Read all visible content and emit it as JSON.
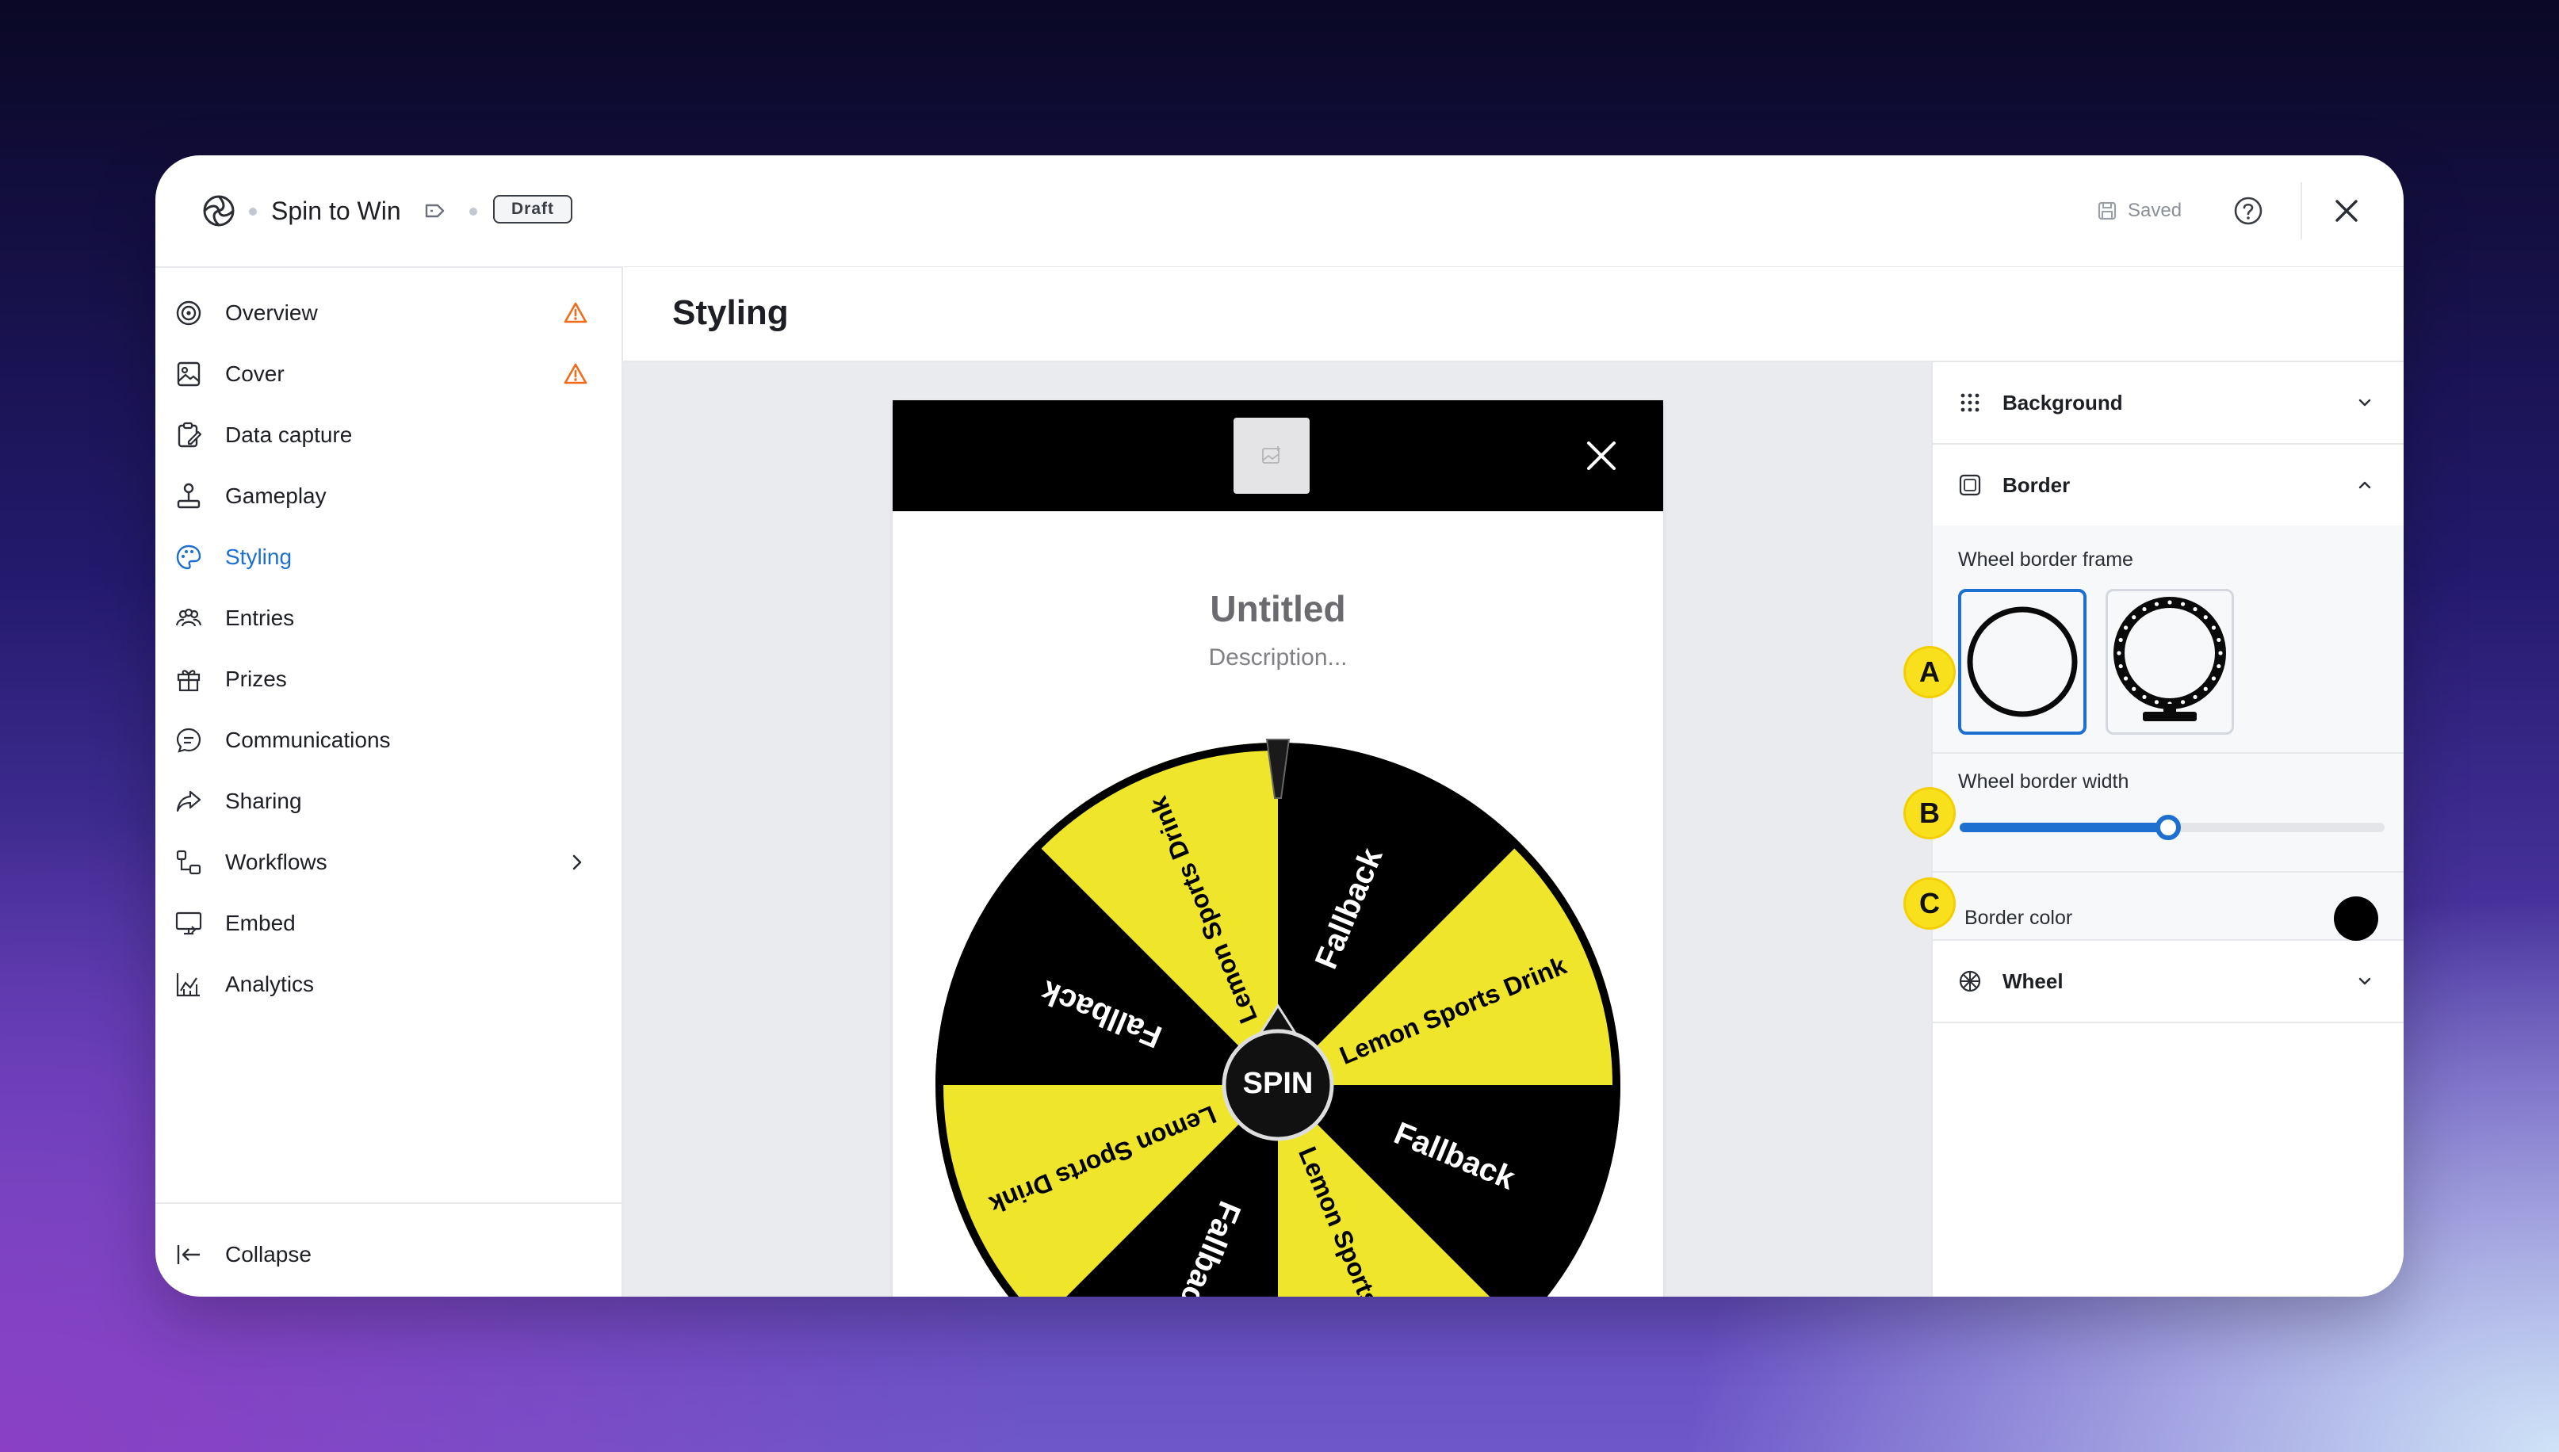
{
  "titlebar": {
    "app_title": "Spin to Win",
    "status_badge": "Draft",
    "saved_label": "Saved"
  },
  "sidebar": {
    "items": [
      {
        "label": "Overview",
        "icon": "target-icon",
        "warning": true
      },
      {
        "label": "Cover",
        "icon": "image-icon",
        "warning": true
      },
      {
        "label": "Data capture",
        "icon": "clipboard-edit-icon",
        "warning": false
      },
      {
        "label": "Gameplay",
        "icon": "joystick-icon",
        "warning": false
      },
      {
        "label": "Styling",
        "icon": "palette-icon",
        "warning": false,
        "active": true
      },
      {
        "label": "Entries",
        "icon": "users-icon",
        "warning": false
      },
      {
        "label": "Prizes",
        "icon": "gift-icon",
        "warning": false
      },
      {
        "label": "Communications",
        "icon": "message-icon",
        "warning": false
      },
      {
        "label": "Sharing",
        "icon": "share-icon",
        "warning": false
      },
      {
        "label": "Workflows",
        "icon": "workflow-icon",
        "warning": false,
        "has_submenu": true
      },
      {
        "label": "Embed",
        "icon": "monitor-code-icon",
        "warning": false
      },
      {
        "label": "Analytics",
        "icon": "chart-icon",
        "warning": false
      }
    ],
    "collapse_label": "Collapse"
  },
  "main": {
    "page_title": "Styling"
  },
  "preview": {
    "title": "Untitled",
    "description": "Description...",
    "spin_label": "SPIN",
    "segments": [
      {
        "label": "Fallback",
        "color": "#000000",
        "text_color": "#ffffff"
      },
      {
        "label": "Lemon Sports Drink",
        "color": "#efe62b",
        "text_color": "#000000"
      },
      {
        "label": "Fallback",
        "color": "#000000",
        "text_color": "#ffffff"
      },
      {
        "label": "Lemon Sports Drink",
        "color": "#efe62b",
        "text_color": "#000000"
      },
      {
        "label": "Fallback",
        "color": "#000000",
        "text_color": "#ffffff"
      },
      {
        "label": "Lemon Sports Drink",
        "color": "#efe62b",
        "text_color": "#000000"
      },
      {
        "label": "Fallback",
        "color": "#000000",
        "text_color": "#ffffff"
      },
      {
        "label": "Lemon Sports Drink",
        "color": "#efe62b",
        "text_color": "#000000"
      }
    ]
  },
  "panel": {
    "background_label": "Background",
    "border_label": "Border",
    "wheel_label": "Wheel",
    "frame_label": "Wheel border frame",
    "width_label": "Wheel border width",
    "width_value": 0.49,
    "color_label": "Border color",
    "border_color": "#000000",
    "accent_color": "#1d6fd0",
    "markers": {
      "a": "A",
      "b": "B",
      "c": "C"
    }
  }
}
